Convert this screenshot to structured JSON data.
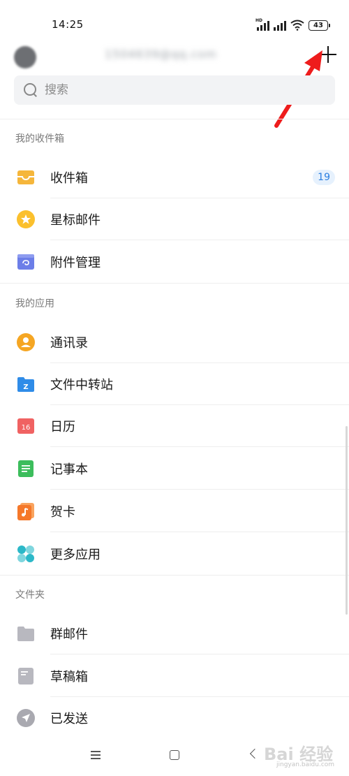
{
  "status_bar": {
    "time": "14:25",
    "battery": "43",
    "network": "HD"
  },
  "header": {
    "account": "1504639@qq.com"
  },
  "search": {
    "placeholder": "搜索"
  },
  "sections": {
    "inbox_title": "我的收件箱",
    "apps_title": "我的应用",
    "folders_title": "文件夹"
  },
  "inbox_items": [
    {
      "label": "收件箱",
      "badge": "19",
      "icon": "inbox-icon",
      "color": "#f5b63b"
    },
    {
      "label": "星标邮件",
      "icon": "star-icon",
      "color": "#fbc02d"
    },
    {
      "label": "附件管理",
      "icon": "attachment-icon",
      "color": "#6c7ee8"
    }
  ],
  "app_items": [
    {
      "label": "通讯录",
      "icon": "contacts-icon",
      "color": "#f5a623"
    },
    {
      "label": "文件中转站",
      "icon": "file-transfer-icon",
      "color": "#2f8ce8"
    },
    {
      "label": "日历",
      "icon": "calendar-icon",
      "color": "#f06262",
      "icon_text": "16"
    },
    {
      "label": "记事本",
      "icon": "notepad-icon",
      "color": "#3cbd5c"
    },
    {
      "label": "贺卡",
      "icon": "greeting-card-icon",
      "color": "#f5782a"
    },
    {
      "label": "更多应用",
      "icon": "more-apps-icon",
      "color": "#2cb8c8"
    }
  ],
  "folder_items": [
    {
      "label": "群邮件",
      "icon": "folder-icon",
      "color": "#b8b8bf"
    },
    {
      "label": "草稿箱",
      "icon": "draft-icon",
      "color": "#b8b8bf"
    },
    {
      "label": "已发送",
      "icon": "sent-icon",
      "color": "#b8b8bf"
    }
  ],
  "watermark": {
    "logo": "Bai 经验",
    "url": "jingyan.baidu.com"
  }
}
